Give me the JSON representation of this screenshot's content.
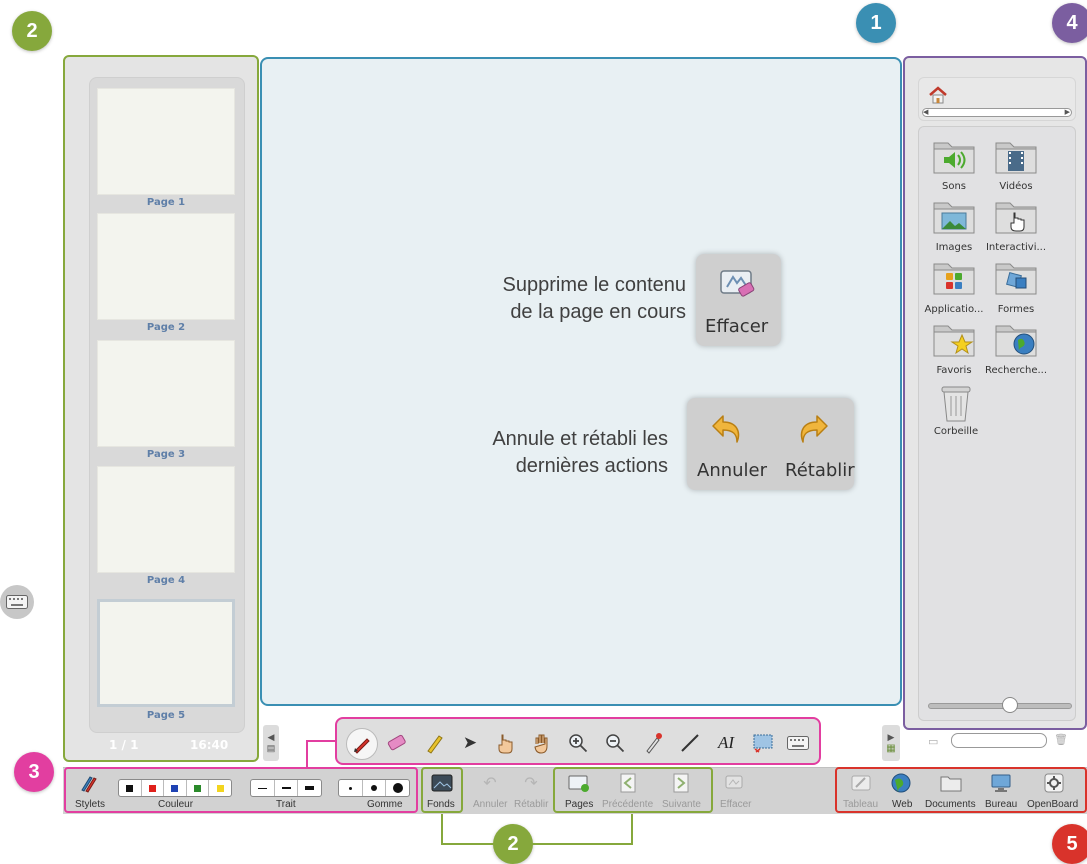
{
  "badges": {
    "board": "1",
    "pages_panel": "2",
    "tools": "3",
    "library": "4",
    "modes": "5",
    "pages_buttons": "2"
  },
  "colors": {
    "board_frame": "#3a8fb3",
    "pages_frame": "#86a83c",
    "tools_frame": "#e23ea0",
    "library_frame": "#7b5ea0",
    "modes_frame": "#d9332b"
  },
  "pages": {
    "items": [
      {
        "label": "Page 1"
      },
      {
        "label": "Page 2"
      },
      {
        "label": "Page 3"
      },
      {
        "label": "Page 4"
      },
      {
        "label": "Page 5"
      }
    ],
    "count": "1 / 1",
    "time": "16:40"
  },
  "board": {
    "erase_callout_line1": "Supprime le contenu",
    "erase_callout_line2": "de la page en cours",
    "erase_tile_label": "Effacer",
    "undo_callout_line1": "Annule et rétabli les",
    "undo_callout_line2": "dernières actions",
    "undo_tile_label": "Annuler",
    "redo_tile_label": "Rétablir"
  },
  "library": {
    "folders": [
      {
        "label": "Sons",
        "icon": "sound-icon"
      },
      {
        "label": "Vidéos",
        "icon": "film-icon"
      },
      {
        "label": "Images",
        "icon": "picture-icon"
      },
      {
        "label": "Interactivi...",
        "icon": "hand-pointer-icon"
      },
      {
        "label": "Applicatio...",
        "icon": "apps-icon"
      },
      {
        "label": "Formes",
        "icon": "shapes-icon"
      },
      {
        "label": "Favoris",
        "icon": "star-icon"
      },
      {
        "label": "Recherche...",
        "icon": "globe-icon"
      },
      {
        "label": "Corbeille",
        "icon": "trash-icon"
      }
    ]
  },
  "bottom": {
    "stylets": "Stylets",
    "couleur": "Couleur",
    "trait": "Trait",
    "gomme": "Gomme",
    "fonds": "Fonds",
    "annuler": "Annuler",
    "retablir": "Rétablir",
    "pages": "Pages",
    "precedente": "Précédente",
    "suivante": "Suivante",
    "effacer": "Effacer",
    "tableau": "Tableau",
    "web": "Web",
    "documents": "Documents",
    "bureau": "Bureau",
    "openboard": "OpenBoard"
  }
}
